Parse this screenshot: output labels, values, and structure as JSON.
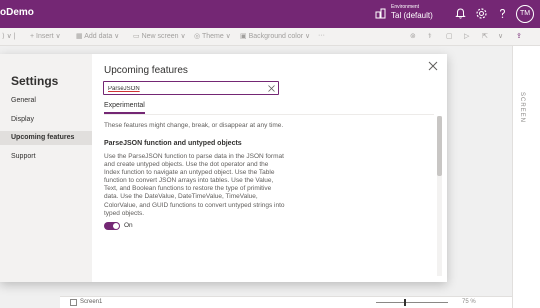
{
  "app": {
    "title": "oDemo",
    "environment_label": "Environment",
    "environment_name": "Tal (default)",
    "user_initials": "TM"
  },
  "toolbar": {
    "insert": "Insert",
    "add_data": "Add data",
    "new_screen": "New screen",
    "theme": "Theme",
    "background_color": "Background color",
    "more": "···"
  },
  "canvas": {
    "right_pane_label": "SCREEN",
    "screen_label": "Screen1",
    "zoom_text": "75 %"
  },
  "settings": {
    "title": "Settings",
    "nav": [
      {
        "label": "General"
      },
      {
        "label": "Display"
      },
      {
        "label": "Upcoming features"
      },
      {
        "label": "Support"
      }
    ],
    "content_title": "Upcoming features",
    "search_value": "ParseJSON",
    "tab_label": "Experimental",
    "hint": "These features might change, break, or disappear at any time.",
    "feature": {
      "title": "ParseJSON function and untyped objects",
      "description": "Use the ParseJSON function to parse data in the JSON format and create untyped objects. Use the dot operator and the Index function to navigate an untyped object. Use the Table function to convert JSON arrays into tables. Use the Value, Text, and Boolean functions to restore the type of primitive data. Use the DateValue, DateTimeValue, TimeValue, ColorValue, and GUID functions to convert untyped strings into typed objects.",
      "toggle_label": "On",
      "enabled": true
    }
  },
  "colors": {
    "brand": "#742774",
    "sidebar_bg": "#f3f2f1"
  }
}
